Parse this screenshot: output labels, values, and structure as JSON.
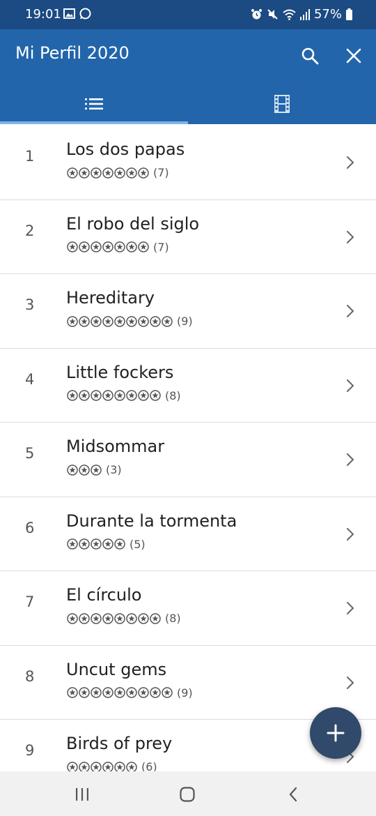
{
  "status_bar": {
    "time": "19:01",
    "battery": "57%"
  },
  "app_bar": {
    "title": "Mi Perfil 2020",
    "actions": [
      {
        "icon": "search-icon"
      },
      {
        "icon": "close-icon"
      }
    ]
  },
  "tabs": [
    {
      "icon": "list-icon",
      "selected": true
    },
    {
      "icon": "film-icon",
      "selected": false
    }
  ],
  "movies": [
    {
      "rank": "1",
      "title": "Los dos papas",
      "stars": 7,
      "count": "(7)"
    },
    {
      "rank": "2",
      "title": "El robo del siglo",
      "stars": 7,
      "count": "(7)"
    },
    {
      "rank": "3",
      "title": "Hereditary",
      "stars": 9,
      "count": "(9)"
    },
    {
      "rank": "4",
      "title": "Little fockers",
      "stars": 8,
      "count": "(8)"
    },
    {
      "rank": "5",
      "title": "Midsommar",
      "stars": 3,
      "count": "(3)"
    },
    {
      "rank": "6",
      "title": "Durante la tormenta",
      "stars": 5,
      "count": "(5)"
    },
    {
      "rank": "7",
      "title": "El círculo",
      "stars": 8,
      "count": "(8)"
    },
    {
      "rank": "8",
      "title": "Uncut gems",
      "stars": 9,
      "count": "(9)"
    },
    {
      "rank": "9",
      "title": "Birds of prey",
      "stars": 6,
      "count": "(6)"
    }
  ],
  "fab": {
    "icon": "plus-icon"
  },
  "colors": {
    "app_bar": "#2265ab",
    "status_bar": "#1c4a82",
    "fab": "#314a6b",
    "tab_indicator": "#7fb3ea"
  }
}
